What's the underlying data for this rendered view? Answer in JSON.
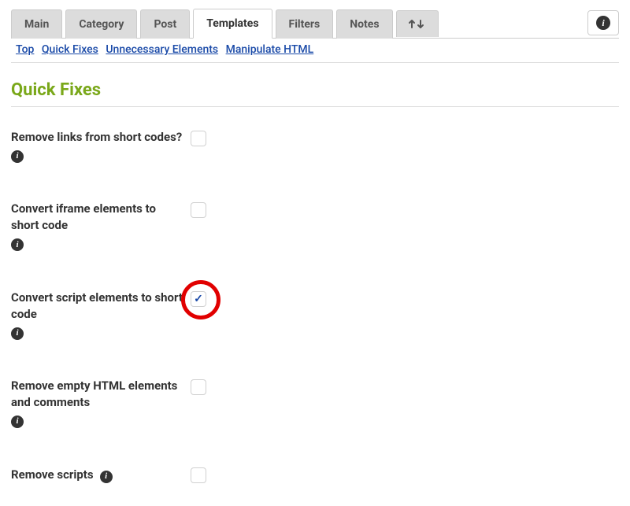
{
  "tabs": {
    "main": "Main",
    "category": "Category",
    "post": "Post",
    "templates": "Templates",
    "filters": "Filters",
    "notes": "Notes"
  },
  "anchors": {
    "top": "Top",
    "quick_fixes": "Quick Fixes",
    "unnecessary": "Unnecessary Elements",
    "manipulate": "Manipulate HTML"
  },
  "section": {
    "title": "Quick Fixes"
  },
  "options": {
    "remove_links": "Remove links from short codes?",
    "convert_iframe": "Convert iframe elements to short code",
    "convert_script": "Convert script elements to short code",
    "remove_empty": "Remove empty HTML elements and comments",
    "remove_scripts": "Remove scripts"
  }
}
